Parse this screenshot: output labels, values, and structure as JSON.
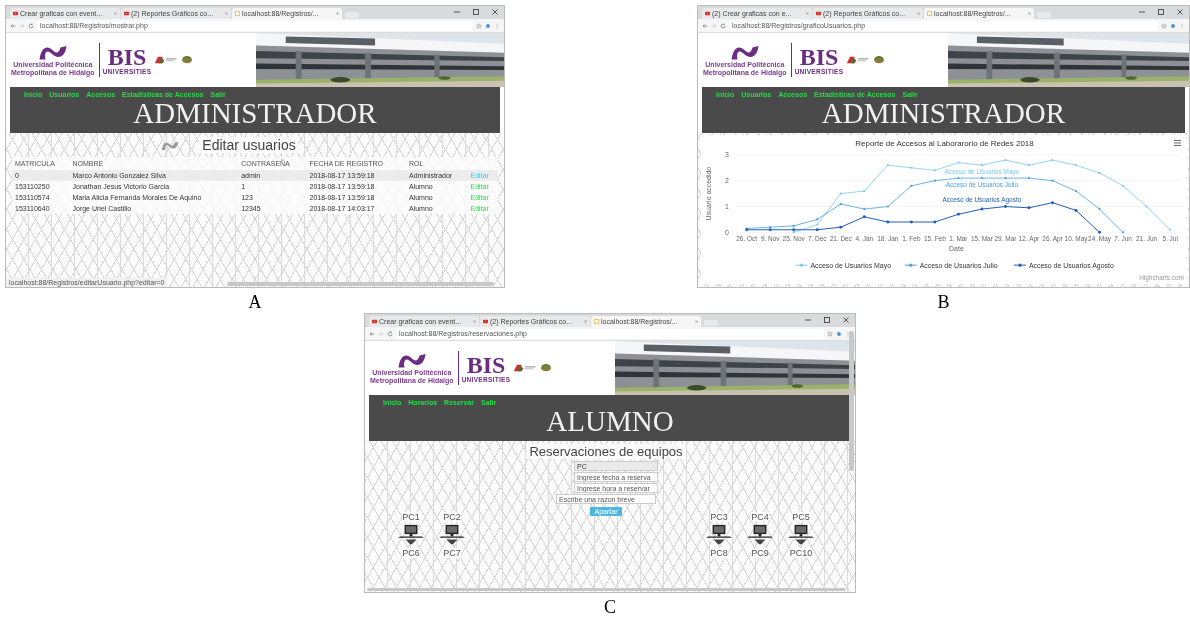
{
  "figures": [
    {
      "label": "A",
      "browser": {
        "tabs": [
          {
            "kind": "video",
            "title": "Crear graficas con event...",
            "selected": false
          },
          {
            "kind": "video",
            "title": "(2) Reportes Gráficos co...",
            "selected": false
          },
          {
            "kind": "page",
            "title": "localhost:88/Registros/...",
            "selected": true
          }
        ],
        "url": "localhost:88/Registros/mostrar.php"
      },
      "header": {
        "university_lines": [
          "Universidad Politécnica",
          "Metropolitana de Hidalgo"
        ],
        "brand": "BIS",
        "brand_sub": "UNIVERSITIES"
      },
      "nav": [
        "Inicio",
        "Usuarios",
        "Accesos",
        "Estadisticas de Accesos",
        "Salir"
      ],
      "role_title": "ADMINISTRADOR",
      "content": {
        "kind": "table",
        "heading": "Editar usuarios",
        "columns": [
          "MATRICULA",
          "NOMBRE",
          "CONTRASEÑA",
          "FECHA DE REGISTRO",
          "ROL"
        ],
        "rows": [
          {
            "cells": [
              "0",
              "Marco Antonio Gonzalez Silva",
              "admin",
              "2018-08-17 13:59:18",
              "Administrador"
            ],
            "action": "Editar",
            "selected": true
          },
          {
            "cells": [
              "153110250",
              "Jonathan Jesus Victorio Garcia",
              "1",
              "2018-08-17 13:59:18",
              "Alumno"
            ],
            "action": "Editar",
            "selected": false
          },
          {
            "cells": [
              "153110574",
              "Maria Alicia Fernanda Morales De Aquino",
              "123",
              "2018-08-17 13:59:18",
              "Alumno"
            ],
            "action": "Editar",
            "selected": false
          },
          {
            "cells": [
              "153110640",
              "Jorge Uriel Castillo",
              "12345",
              "2018-08-17 14:03:17",
              "Alumno"
            ],
            "action": "Editar",
            "selected": false
          }
        ]
      },
      "status_url": "localhost:88/Registros/editarUsuario.php?editar=0"
    },
    {
      "label": "B",
      "browser": {
        "tabs": [
          {
            "kind": "video",
            "title": "(2) Crear graficas con e...",
            "selected": false
          },
          {
            "kind": "video",
            "title": "(2) Reportes Gráficos co...",
            "selected": false
          },
          {
            "kind": "page",
            "title": "localhost:88/Registros/...",
            "selected": true
          }
        ],
        "url": "localhost:88/Registros/graficoUsuarios.php"
      },
      "header": {
        "university_lines": [
          "Universidad Politécnica",
          "Metropolitana de Hidalgo"
        ],
        "brand": "BIS",
        "brand_sub": "UNIVERSITIES"
      },
      "nav": [
        "Inicio",
        "Usuarios",
        "Accesos",
        "Estadisticas de Accesos",
        "Salir"
      ],
      "role_title": "ADMINISTRADOR",
      "content": {
        "kind": "chart",
        "credits": "Highcharts.com",
        "chart_data": {
          "type": "line",
          "title": "Reporte de Accesos al Laborarorio de Redes 2018",
          "xlabel": "Date",
          "ylabel": "Usuario accedido",
          "categories": [
            "26. Oct",
            "9. Nov",
            "25. Nov",
            "7. Dec",
            "21. Dec",
            "4. Jan",
            "18. Jan",
            "1. Feb",
            "15. Feb",
            "1. Mar",
            "15. Mar",
            "29. Mar",
            "12. Apr",
            "26. Apr",
            "10. May",
            "24. May",
            "7. Jun",
            "21. Jun",
            "5. Jul"
          ],
          "ylim": [
            0,
            3
          ],
          "yticks": [
            0,
            1,
            2,
            3
          ],
          "legend": "bottom",
          "series": [
            {
              "name": "Acceso de Usuarios Mayo",
              "color": "#7cc7f0",
              "values": [
                null,
                null,
                0,
                0.3,
                1.5,
                1.6,
                2.6,
                2.5,
                2.4,
                2.7,
                2.6,
                2.8,
                2.6,
                2.8,
                2.6,
                2.3,
                1.8,
                1.0,
                0.1
              ]
            },
            {
              "name": "Acceso de Usuarios Julio",
              "color": "#4a9fdf",
              "values": [
                0.15,
                0.2,
                0.25,
                0.5,
                1.1,
                0.9,
                1.0,
                1.8,
                2.0,
                2.1,
                2.1,
                2.1,
                2.1,
                2.0,
                1.6,
                0.9,
                0,
                null,
                null
              ]
            },
            {
              "name": "Acceso de Usuarios Agosto",
              "color": "#1f5fb8",
              "values": [
                0.1,
                0.1,
                0.1,
                0.1,
                0.2,
                0.6,
                0.4,
                0.4,
                0.4,
                0.7,
                0.9,
                1.0,
                0.95,
                1.15,
                0.85,
                0,
                null,
                null,
                null
              ]
            }
          ],
          "annotations": [
            {
              "text": "Acceso de Usuarios Mayo"
            },
            {
              "text": "Acceso de Usuarios Julio"
            },
            {
              "text": "Acceso de Usuarios Agosto"
            }
          ]
        }
      }
    },
    {
      "label": "C",
      "browser": {
        "tabs": [
          {
            "kind": "video",
            "title": "Crear graficas con event...",
            "selected": false
          },
          {
            "kind": "video",
            "title": "(2) Reportes Gráficos co...",
            "selected": false
          },
          {
            "kind": "page",
            "title": "localhost:88/Registros/...",
            "selected": true
          }
        ],
        "url": "localhost:88/Registros/reservaciones.php"
      },
      "header": {
        "university_lines": [
          "Universidad Politécnica",
          "Metropolitana de Hidalgo"
        ],
        "brand": "BIS",
        "brand_sub": "UNIVERSITIES"
      },
      "nav": [
        "Inicio",
        "Horarios",
        "Reservar",
        "Salir"
      ],
      "role_title": "ALUMNO",
      "content": {
        "kind": "reservation",
        "heading": "Reservaciones de equipos",
        "fields": [
          {
            "value": "PC"
          },
          {
            "placeholder": "Ingrese fecha a reserva"
          },
          {
            "placeholder": "Ingrese hora a reservar"
          },
          {
            "placeholder": "Escribe una razon breve"
          }
        ],
        "button": "Apartar",
        "left_stations": [
          {
            "top": "PC1",
            "bottom": "PC6"
          },
          {
            "top": "PC2",
            "bottom": "PC7"
          }
        ],
        "right_stations": [
          {
            "top": "PC3",
            "bottom": "PC8"
          },
          {
            "top": "PC4",
            "bottom": "PC9"
          },
          {
            "top": "PC5",
            "bottom": "PC10"
          }
        ]
      }
    }
  ]
}
